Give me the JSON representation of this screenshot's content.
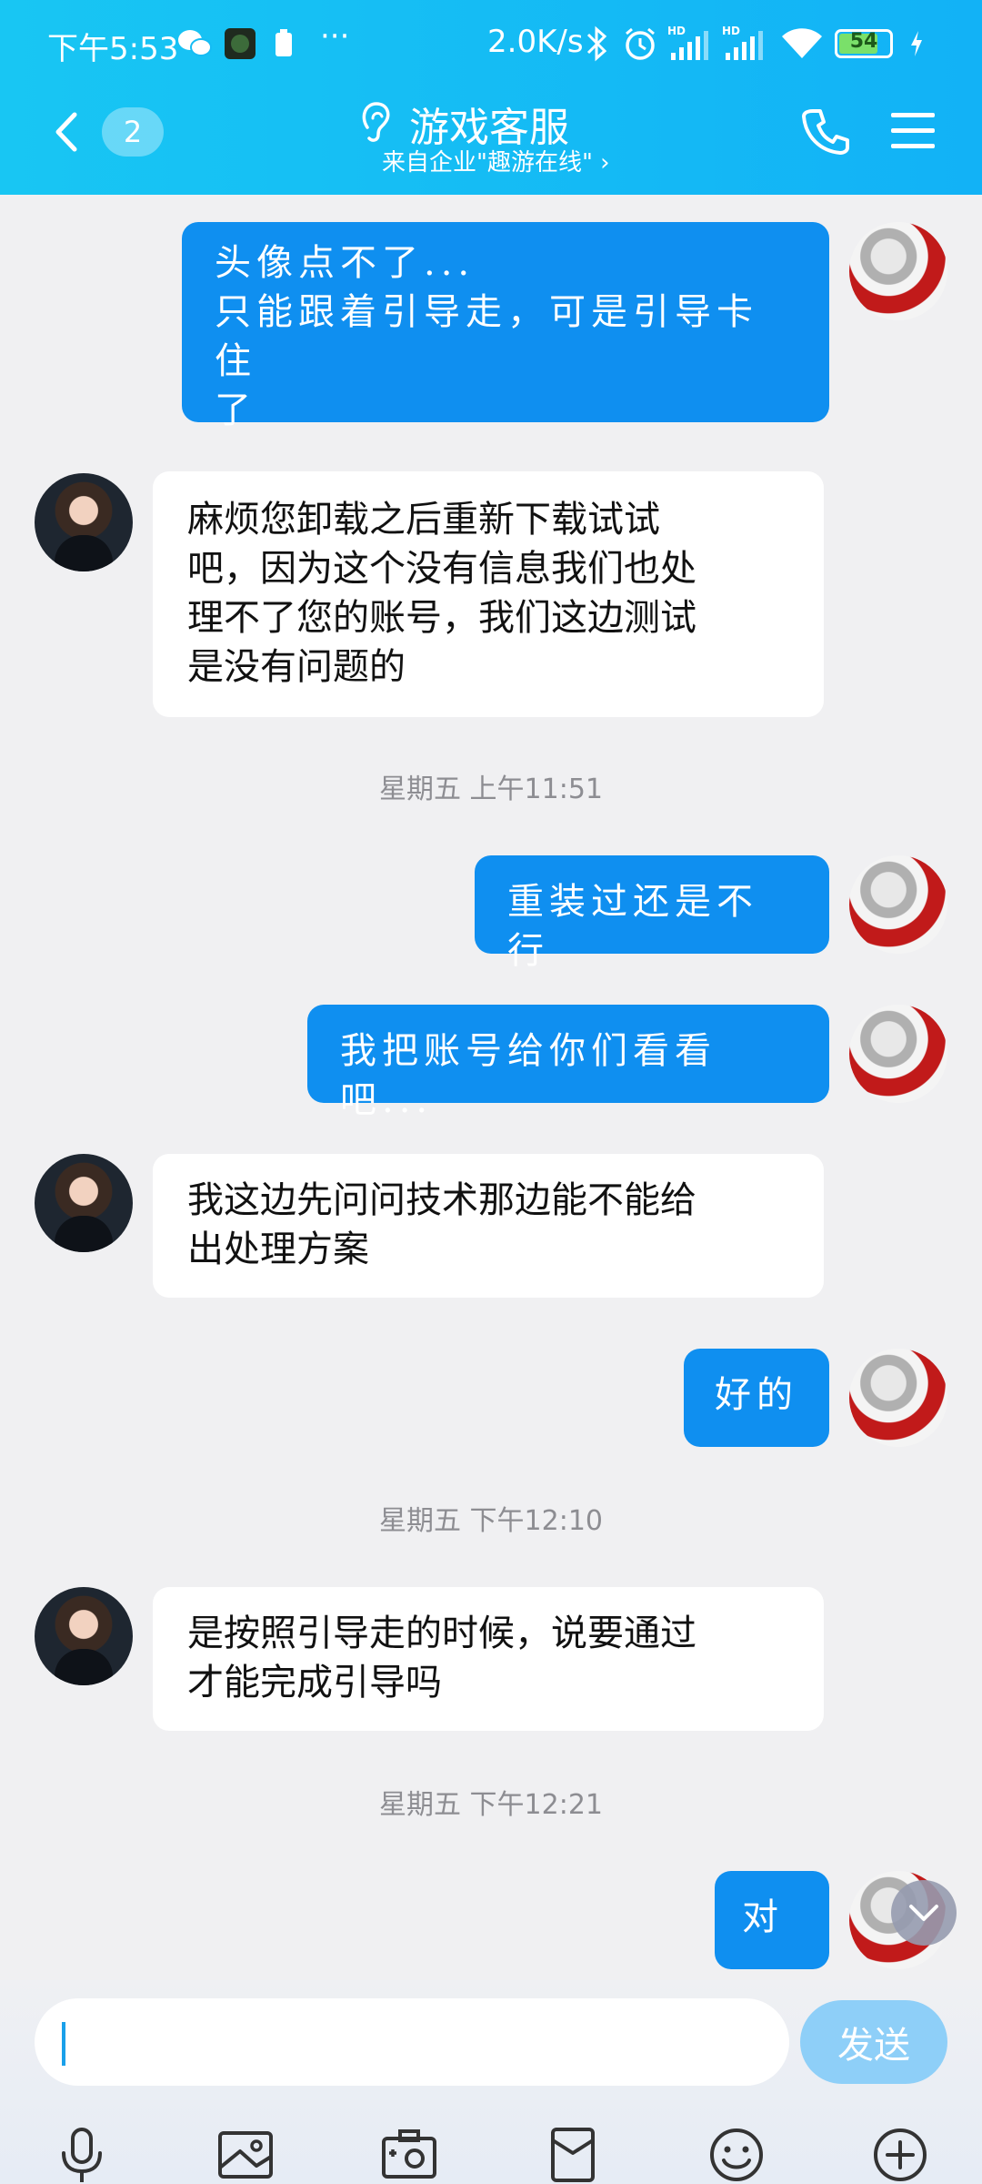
{
  "status_bar": {
    "time": "下午5:53",
    "dots": "···",
    "net_speed": "2.0K/s",
    "battery_level": "54",
    "hd1": "HD",
    "hd2": "HD"
  },
  "header": {
    "unread_count": "2",
    "title": "游戏客服",
    "subtitle": "来自企业\"趣游在线\" ›"
  },
  "messages": [
    {
      "type": "out",
      "lines": [
        "头像点不了...",
        "只能跟着引导走，可是引导卡住",
        "了"
      ]
    },
    {
      "type": "in",
      "lines": [
        "麻烦您卸载之后重新下载试试",
        "吧，因为这个没有信息我们也处",
        "理不了您的账号，我们这边测试",
        "是没有问题的"
      ]
    },
    {
      "type": "time",
      "text": "星期五 上午11:51"
    },
    {
      "type": "out",
      "lines": [
        "重装过还是不行"
      ]
    },
    {
      "type": "out",
      "lines": [
        "我把账号给你们看看吧..."
      ]
    },
    {
      "type": "in",
      "lines": [
        "我这边先问问技术那边能不能给",
        "出处理方案"
      ]
    },
    {
      "type": "out",
      "lines": [
        "好的"
      ]
    },
    {
      "type": "time",
      "text": "星期五 下午12:10"
    },
    {
      "type": "in",
      "lines": [
        "是按照引导走的时候，说要通过",
        "才能完成引导吗"
      ]
    },
    {
      "type": "time",
      "text": "星期五 下午12:21"
    },
    {
      "type": "out",
      "lines": [
        "对"
      ]
    }
  ],
  "input": {
    "value": "",
    "send_label": "发送"
  },
  "toolbar": [
    "microphone-icon",
    "photo-icon",
    "camera-icon",
    "file-icon",
    "emoji-icon",
    "plus-icon"
  ],
  "colors": {
    "header": "#15bcf4",
    "outgoing_bubble": "#0f8ff0",
    "incoming_bubble": "#ffffff",
    "send_button": "#8ecff8"
  }
}
